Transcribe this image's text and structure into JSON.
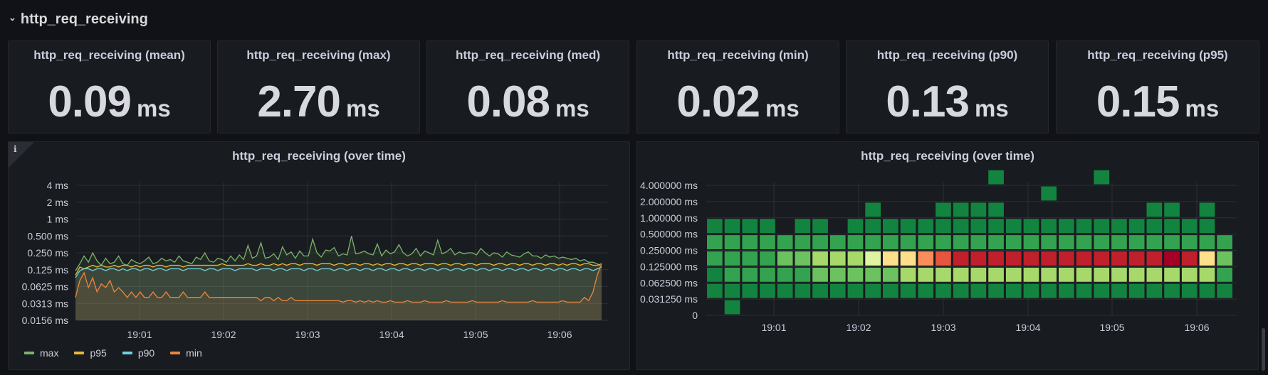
{
  "row": {
    "title": "http_req_receiving"
  },
  "stats": [
    {
      "title": "http_req_receiving (mean)",
      "value": "0.09",
      "unit": "ms"
    },
    {
      "title": "http_req_receiving (max)",
      "value": "2.70",
      "unit": "ms"
    },
    {
      "title": "http_req_receiving (med)",
      "value": "0.08",
      "unit": "ms"
    },
    {
      "title": "http_req_receiving (min)",
      "value": "0.02",
      "unit": "ms"
    },
    {
      "title": "http_req_receiving (p90)",
      "value": "0.13",
      "unit": "ms"
    },
    {
      "title": "http_req_receiving (p95)",
      "value": "0.15",
      "unit": "ms"
    }
  ],
  "colors": {
    "max": "#7eb26d",
    "p95": "#eab839",
    "p90": "#6ed0e0",
    "min": "#ef843c",
    "heat_ramp": [
      "#0b6b35",
      "#12843f",
      "#33a34f",
      "#6cc25e",
      "#a7d96a",
      "#e0f3a0",
      "#fee08b",
      "#fc8d59",
      "#e8553e",
      "#c0202c",
      "#a50026"
    ]
  },
  "timeseries_panel": {
    "title": "http_req_receiving (over time)",
    "info_icon": "info-icon",
    "legend": [
      {
        "name": "max",
        "color": "#7eb26d"
      },
      {
        "name": "p95",
        "color": "#eab839"
      },
      {
        "name": "p90",
        "color": "#6ed0e0"
      },
      {
        "name": "min",
        "color": "#ef843c"
      }
    ]
  },
  "heatmap_panel": {
    "title": "http_req_receiving (over time)"
  },
  "chart_data": [
    {
      "type": "line",
      "title": "http_req_receiving (over time)",
      "y_scale": "log2",
      "y_ticks": [
        "4 ms",
        "2 ms",
        "1 ms",
        "0.500 ms",
        "0.250 ms",
        "0.125 ms",
        "0.0625 ms",
        "0.0313 ms",
        "0.0156 ms"
      ],
      "y_tick_values": [
        4,
        2,
        1,
        0.5,
        0.25,
        0.125,
        0.0625,
        0.03125,
        0.015625
      ],
      "x_ticks": [
        "19:01",
        "19:02",
        "19:03",
        "19:04",
        "19:05",
        "19:06"
      ],
      "grid": true,
      "legend_position": "bottom-left",
      "series_note": "values are approximate per-interval readings in ms, sampled every 6s from ~19:00:18 to ~19:06:20",
      "series": [
        {
          "name": "max",
          "values": [
            0.12,
            0.16,
            0.22,
            0.17,
            0.25,
            0.18,
            0.15,
            0.2,
            0.16,
            0.17,
            0.22,
            0.16,
            0.15,
            0.19,
            0.17,
            0.16,
            0.18,
            0.21,
            0.16,
            0.17,
            0.2,
            0.18,
            0.19,
            0.17,
            0.22,
            0.18,
            0.17,
            0.16,
            0.21,
            0.19,
            0.25,
            0.18,
            0.17,
            0.2,
            0.19,
            0.17,
            0.22,
            0.18,
            0.23,
            0.19,
            0.34,
            0.2,
            0.22,
            0.38,
            0.2,
            0.21,
            0.24,
            0.19,
            0.32,
            0.23,
            0.26,
            0.2,
            0.27,
            0.22,
            0.22,
            0.44,
            0.25,
            0.21,
            0.28,
            0.27,
            0.31,
            0.22,
            0.24,
            0.23,
            0.5,
            0.24,
            0.25,
            0.27,
            0.24,
            0.23,
            0.36,
            0.22,
            0.28,
            0.24,
            0.26,
            0.35,
            0.25,
            0.22,
            0.24,
            0.3,
            0.22,
            0.27,
            0.25,
            0.23,
            0.42,
            0.24,
            0.26,
            0.3,
            0.23,
            0.26,
            0.24,
            0.25,
            0.25,
            0.23,
            0.3,
            0.25,
            0.22,
            0.25,
            0.24,
            0.21,
            0.26,
            0.23,
            0.22,
            0.21,
            0.24,
            0.26,
            0.22,
            0.22,
            0.2,
            0.23,
            0.21,
            0.22,
            0.2,
            0.21,
            0.2,
            0.19,
            0.2,
            0.18,
            0.19,
            0.17,
            0.17,
            0.16,
            0.14
          ]
        },
        {
          "name": "p95",
          "values": [
            0.1,
            0.14,
            0.13,
            0.14,
            0.15,
            0.14,
            0.15,
            0.14,
            0.14,
            0.15,
            0.14,
            0.15,
            0.15,
            0.14,
            0.15,
            0.14,
            0.15,
            0.15,
            0.14,
            0.15,
            0.15,
            0.14,
            0.15,
            0.15,
            0.15,
            0.14,
            0.15,
            0.15,
            0.15,
            0.15,
            0.15,
            0.15,
            0.15,
            0.15,
            0.16,
            0.15,
            0.15,
            0.15,
            0.15,
            0.15,
            0.16,
            0.15,
            0.15,
            0.16,
            0.15,
            0.15,
            0.16,
            0.15,
            0.16,
            0.15,
            0.16,
            0.16,
            0.15,
            0.16,
            0.16,
            0.16,
            0.15,
            0.16,
            0.16,
            0.16,
            0.15,
            0.16,
            0.16,
            0.15,
            0.16,
            0.16,
            0.15,
            0.16,
            0.16,
            0.15,
            0.16,
            0.15,
            0.16,
            0.16,
            0.15,
            0.16,
            0.16,
            0.15,
            0.16,
            0.16,
            0.15,
            0.16,
            0.16,
            0.16,
            0.15,
            0.16,
            0.16,
            0.15,
            0.16,
            0.16,
            0.15,
            0.16,
            0.16,
            0.15,
            0.16,
            0.16,
            0.16,
            0.15,
            0.16,
            0.16,
            0.15,
            0.16,
            0.16,
            0.15,
            0.16,
            0.16,
            0.15,
            0.16,
            0.16,
            0.15,
            0.16,
            0.16,
            0.15,
            0.16,
            0.15,
            0.16,
            0.16,
            0.15,
            0.16,
            0.16,
            0.15,
            0.15,
            0.16
          ]
        },
        {
          "name": "p90",
          "values": [
            0.09,
            0.12,
            0.13,
            0.13,
            0.12,
            0.13,
            0.13,
            0.12,
            0.13,
            0.13,
            0.12,
            0.13,
            0.12,
            0.13,
            0.13,
            0.12,
            0.13,
            0.13,
            0.12,
            0.13,
            0.13,
            0.12,
            0.13,
            0.13,
            0.13,
            0.12,
            0.13,
            0.13,
            0.13,
            0.13,
            0.12,
            0.13,
            0.13,
            0.12,
            0.13,
            0.13,
            0.13,
            0.12,
            0.13,
            0.13,
            0.13,
            0.13,
            0.12,
            0.13,
            0.13,
            0.13,
            0.12,
            0.13,
            0.13,
            0.12,
            0.13,
            0.13,
            0.13,
            0.12,
            0.13,
            0.13,
            0.12,
            0.13,
            0.13,
            0.13,
            0.12,
            0.13,
            0.13,
            0.12,
            0.13,
            0.13,
            0.12,
            0.13,
            0.13,
            0.12,
            0.13,
            0.13,
            0.12,
            0.13,
            0.13,
            0.12,
            0.13,
            0.13,
            0.12,
            0.13,
            0.13,
            0.12,
            0.13,
            0.13,
            0.12,
            0.13,
            0.13,
            0.12,
            0.13,
            0.13,
            0.12,
            0.13,
            0.13,
            0.12,
            0.13,
            0.13,
            0.12,
            0.13,
            0.13,
            0.12,
            0.13,
            0.13,
            0.12,
            0.13,
            0.13,
            0.12,
            0.13,
            0.13,
            0.12,
            0.13,
            0.13,
            0.12,
            0.13,
            0.13,
            0.12,
            0.13,
            0.13,
            0.12,
            0.13,
            0.13,
            0.12,
            0.13,
            0.14
          ]
        },
        {
          "name": "min",
          "values": [
            0.04,
            0.08,
            0.11,
            0.06,
            0.09,
            0.05,
            0.07,
            0.06,
            0.08,
            0.05,
            0.06,
            0.05,
            0.04,
            0.05,
            0.04,
            0.05,
            0.04,
            0.04,
            0.05,
            0.04,
            0.04,
            0.05,
            0.04,
            0.04,
            0.04,
            0.05,
            0.04,
            0.04,
            0.04,
            0.04,
            0.05,
            0.04,
            0.04,
            0.04,
            0.04,
            0.04,
            0.04,
            0.04,
            0.04,
            0.04,
            0.04,
            0.04,
            0.04,
            0.035,
            0.04,
            0.04,
            0.035,
            0.04,
            0.035,
            0.035,
            0.04,
            0.035,
            0.035,
            0.035,
            0.035,
            0.035,
            0.035,
            0.035,
            0.035,
            0.035,
            0.035,
            0.035,
            0.033,
            0.035,
            0.035,
            0.033,
            0.035,
            0.033,
            0.035,
            0.033,
            0.035,
            0.033,
            0.033,
            0.035,
            0.033,
            0.033,
            0.033,
            0.035,
            0.033,
            0.033,
            0.033,
            0.035,
            0.033,
            0.033,
            0.033,
            0.033,
            0.035,
            0.033,
            0.033,
            0.033,
            0.033,
            0.033,
            0.035,
            0.033,
            0.033,
            0.033,
            0.033,
            0.033,
            0.033,
            0.035,
            0.033,
            0.033,
            0.033,
            0.033,
            0.033,
            0.033,
            0.035,
            0.033,
            0.033,
            0.033,
            0.033,
            0.033,
            0.033,
            0.035,
            0.033,
            0.033,
            0.033,
            0.033,
            0.04,
            0.035,
            0.05,
            0.1,
            0.16
          ]
        }
      ]
    },
    {
      "type": "heatmap",
      "title": "http_req_receiving (over time)",
      "y_buckets": [
        "0",
        "0.031250 ms",
        "0.062500 ms",
        "0.125000 ms",
        "0.250000 ms",
        "0.500000 ms",
        "1.000000 ms",
        "2.000000 ms",
        "4.000000 ms"
      ],
      "x_ticks": [
        "19:01",
        "19:02",
        "19:03",
        "19:04",
        "19:05",
        "19:06"
      ],
      "grid": true,
      "color_scale": "count: 0 = empty, 1..10 = dark green to dark red",
      "columns": 30,
      "rows_note": "each row lists count intensity (0-10) per time column; row 0 = bucket 0..0.03125 ms",
      "cells": [
        [
          0,
          1,
          0,
          0,
          0,
          0,
          0,
          0,
          0,
          0,
          0,
          0,
          0,
          0,
          0,
          0,
          0,
          0,
          0,
          0,
          0,
          0,
          0,
          0,
          0,
          0,
          0,
          0,
          0,
          0
        ],
        [
          1,
          1,
          1,
          1,
          1,
          1,
          1,
          1,
          1,
          1,
          1,
          1,
          1,
          1,
          1,
          1,
          1,
          1,
          1,
          1,
          1,
          1,
          1,
          1,
          1,
          1,
          1,
          1,
          1,
          1
        ],
        [
          1,
          2,
          2,
          2,
          2,
          2,
          3,
          3,
          3,
          3,
          3,
          4,
          4,
          4,
          4,
          4,
          4,
          4,
          4,
          4,
          4,
          4,
          4,
          4,
          4,
          4,
          4,
          4,
          4,
          2
        ],
        [
          2,
          2,
          2,
          2,
          3,
          3,
          4,
          4,
          4,
          5,
          6,
          6,
          7,
          8,
          9,
          9,
          9,
          9,
          9,
          9,
          9,
          9,
          9,
          9,
          9,
          9,
          10,
          9,
          6,
          3
        ],
        [
          2,
          2,
          2,
          2,
          2,
          2,
          2,
          2,
          2,
          2,
          2,
          2,
          2,
          2,
          2,
          2,
          2,
          2,
          2,
          2,
          2,
          2,
          2,
          2,
          2,
          2,
          2,
          2,
          2,
          2
        ],
        [
          1,
          1,
          1,
          1,
          0,
          1,
          1,
          0,
          1,
          1,
          1,
          1,
          1,
          1,
          1,
          1,
          1,
          1,
          1,
          1,
          1,
          1,
          1,
          1,
          1,
          1,
          1,
          1,
          1,
          0
        ],
        [
          0,
          0,
          0,
          0,
          0,
          0,
          0,
          0,
          0,
          1,
          0,
          0,
          0,
          1,
          1,
          1,
          1,
          0,
          0,
          0,
          0,
          0,
          0,
          0,
          0,
          1,
          1,
          0,
          1,
          0
        ],
        [
          0,
          0,
          0,
          0,
          0,
          0,
          0,
          0,
          0,
          0,
          0,
          0,
          0,
          0,
          0,
          0,
          0,
          0,
          0,
          1,
          0,
          0,
          0,
          0,
          0,
          0,
          0,
          0,
          0,
          0
        ],
        [
          0,
          0,
          0,
          0,
          0,
          0,
          0,
          0,
          0,
          0,
          0,
          0,
          0,
          0,
          0,
          0,
          1,
          0,
          0,
          0,
          0,
          0,
          1,
          0,
          0,
          0,
          0,
          0,
          0,
          0
        ]
      ]
    }
  ]
}
